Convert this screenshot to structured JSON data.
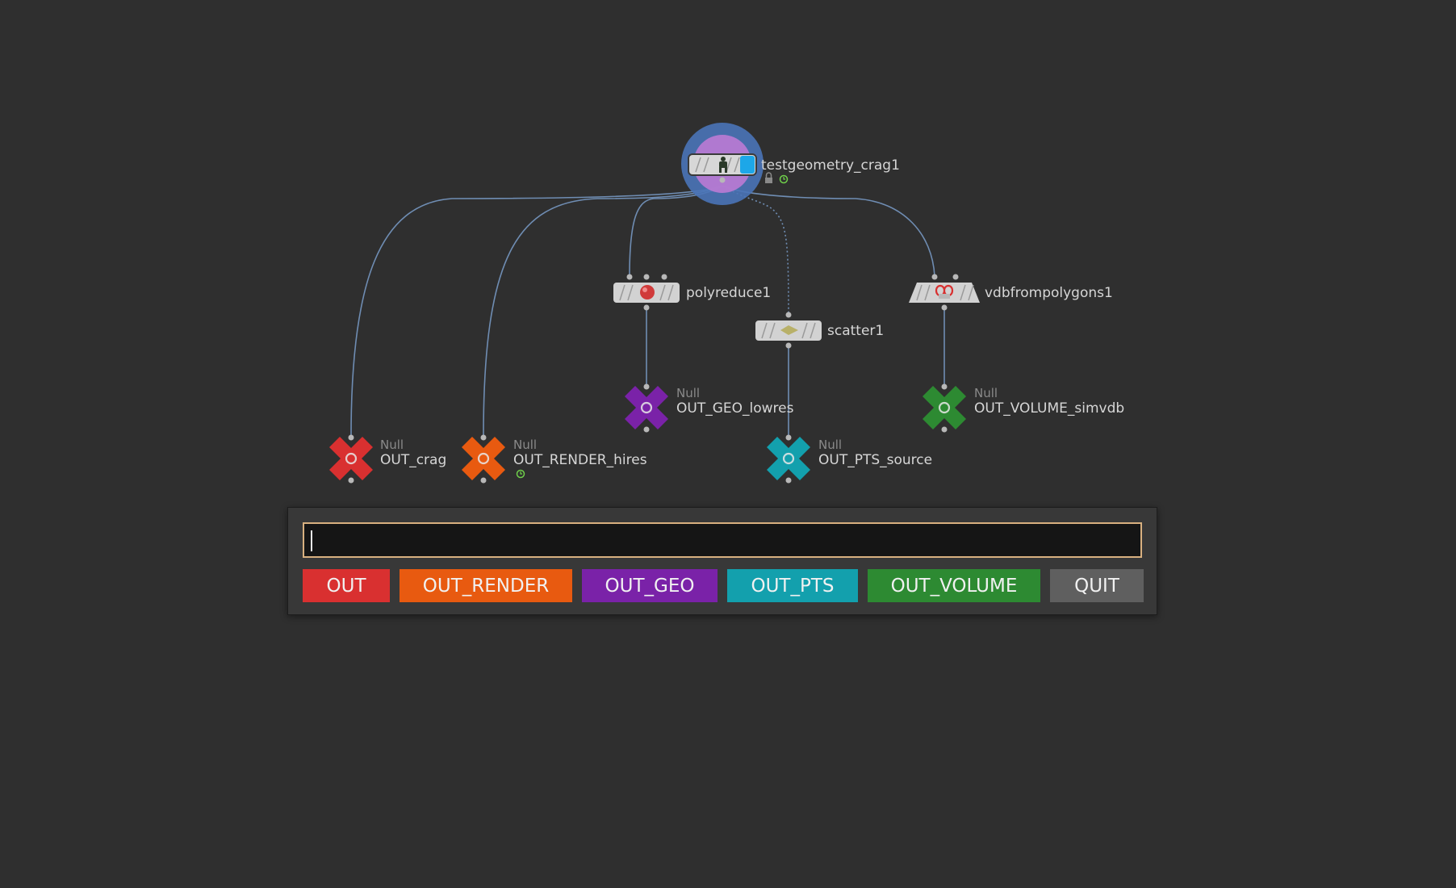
{
  "nodes": {
    "testgeometry": {
      "name": "testgeometry_crag1"
    },
    "polyreduce": {
      "name": "polyreduce1"
    },
    "scatter": {
      "name": "scatter1"
    },
    "vdbfrompolygons": {
      "name": "vdbfrompolygons1"
    },
    "out_crag": {
      "type": "Null",
      "name": "OUT_crag",
      "color": "#d93030"
    },
    "out_render": {
      "type": "Null",
      "name": "OUT_RENDER_hires",
      "color": "#e85a10"
    },
    "out_geo": {
      "type": "Null",
      "name": "OUT_GEO_lowres",
      "color": "#7a22a8"
    },
    "out_pts": {
      "type": "Null",
      "name": "OUT_PTS_source",
      "color": "#13a0ad"
    },
    "out_volume": {
      "type": "Null",
      "name": "OUT_VOLUME_simvdb",
      "color": "#2d8a32"
    }
  },
  "dialog": {
    "input_value": "",
    "buttons": [
      {
        "label": "OUT",
        "color": "#d93030"
      },
      {
        "label": "OUT_RENDER",
        "color": "#e85a10"
      },
      {
        "label": "OUT_GEO",
        "color": "#7a22a8"
      },
      {
        "label": "OUT_PTS",
        "color": "#13a0ad"
      },
      {
        "label": "OUT_VOLUME",
        "color": "#2d8a32"
      },
      {
        "label": "QUIT",
        "color": "#5f5f5f"
      }
    ]
  }
}
